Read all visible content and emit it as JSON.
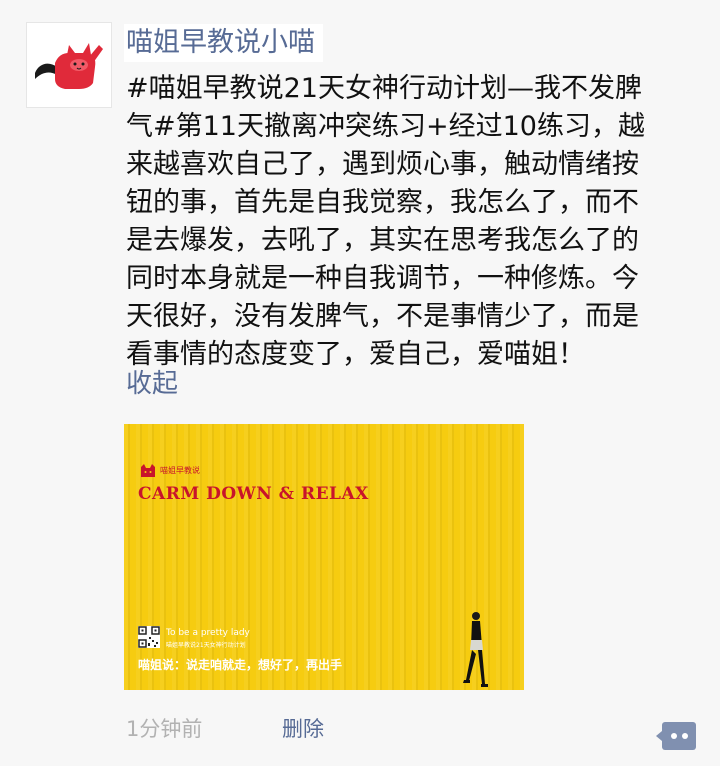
{
  "post": {
    "author": "喵姐早教说小喵",
    "text_lines": [
      "#喵姐早教说21天女神行动计划—我不发脾",
      "气#第11天撤离冲突练习+经过10练习，越",
      "来越喜欢自己了，遇到烦心事，触动情绪按",
      "钮的事，首先是自我觉察，我怎么了，而不",
      "是去爆发，去吼了，其实在思考我怎么了的",
      "同时本身就是一种自我调节，一种修炼。今",
      "天很好，没有发脾气，不是事情少了，而是",
      "看事情的态度变了，爱自己，爱喵姐！"
    ],
    "collapse_label": "收起",
    "timestamp": "1分钟前",
    "delete_label": "删除"
  },
  "image": {
    "brand": "喵姐早教说",
    "headline": "CARM  DOWN & RELAX",
    "tagline_en": "To be a pretty lady",
    "tagline_sub": "喵姐早教说21天女神行动计划",
    "caption": "喵姐说：说走咱就走，想好了，再出手"
  },
  "colors": {
    "link": "#576b95",
    "text": "#111111",
    "meta": "#b2b2b2",
    "photo_yellow": "#f6cc10",
    "headline_red": "#c8142b"
  },
  "icons": {
    "avatar": "red-cat-avatar",
    "comment": "comment-dots-icon"
  }
}
